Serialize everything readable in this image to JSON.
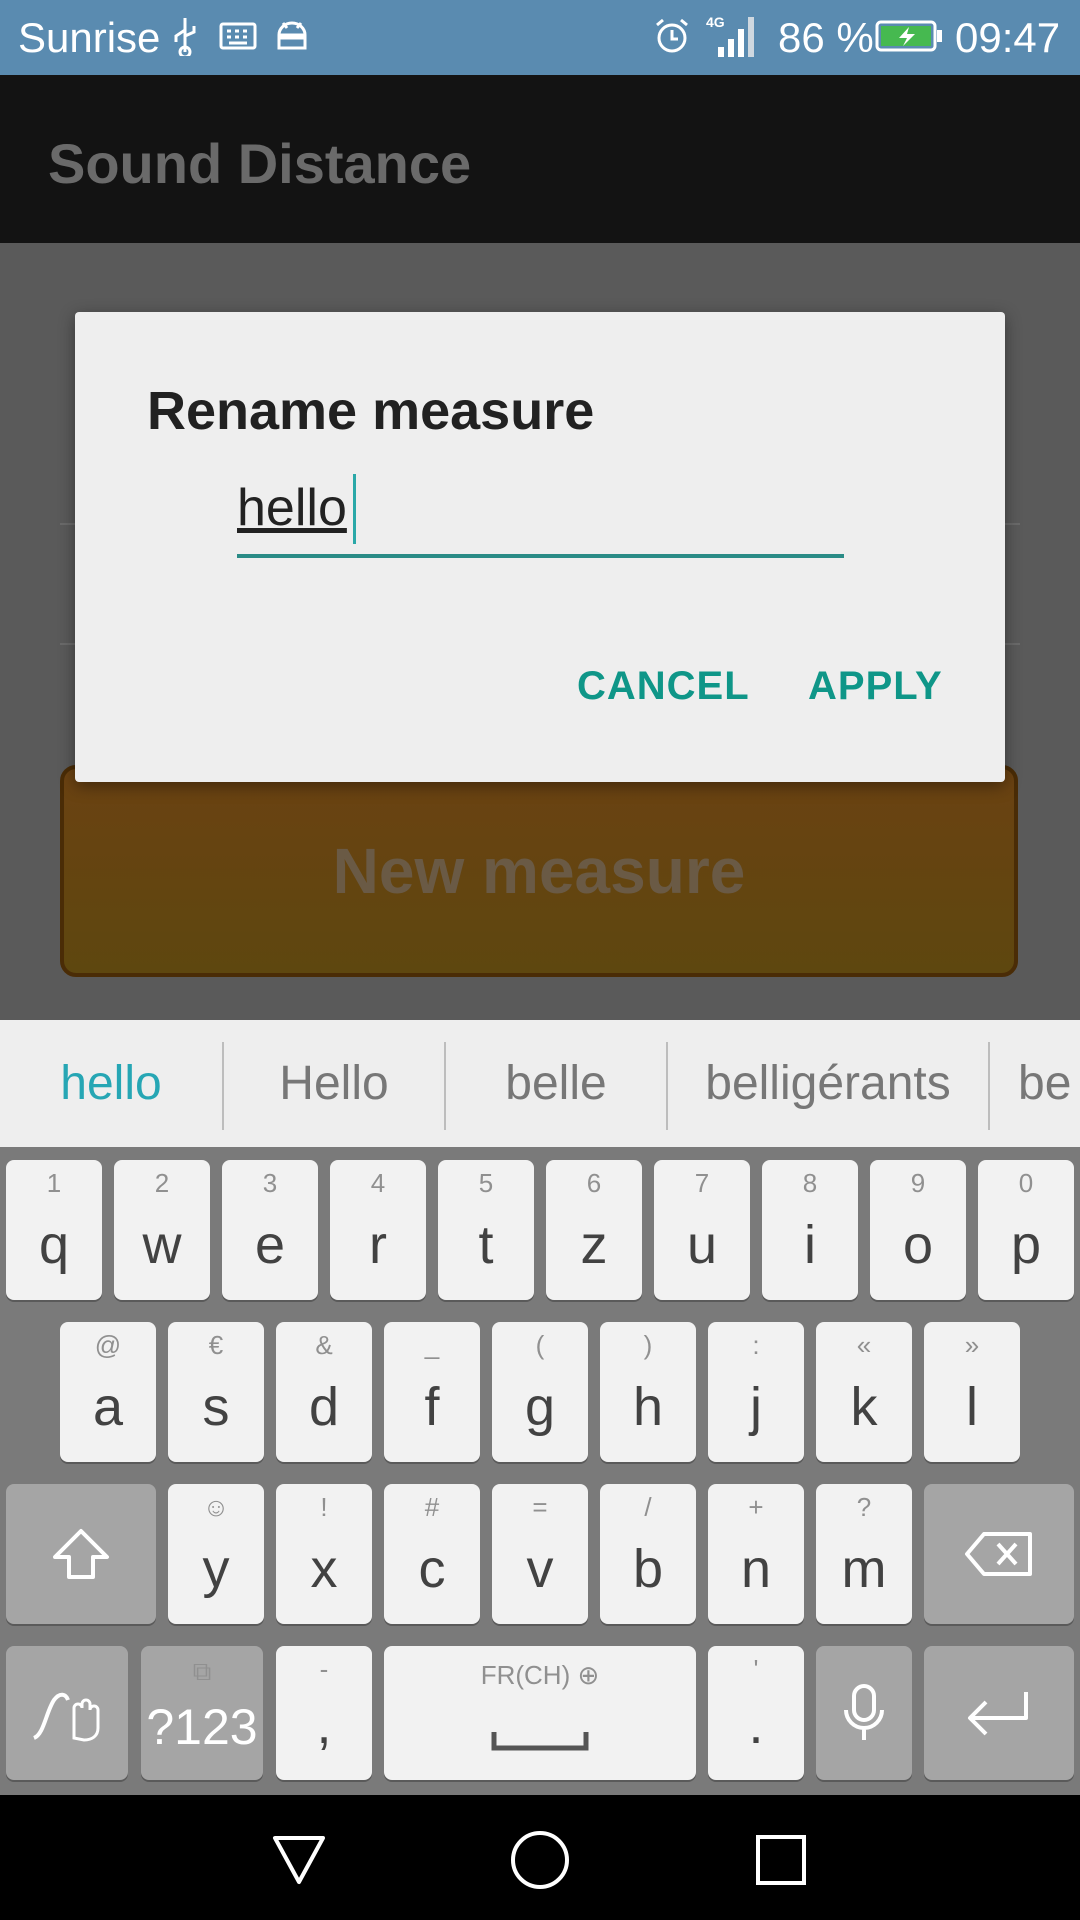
{
  "status": {
    "carrier": "Sunrise",
    "network": "4G",
    "battery_pct": "86 %",
    "time": "09:47",
    "icons": [
      "usb-icon",
      "keyboard-icon",
      "android-icon",
      "alarm-icon",
      "signal-icon",
      "battery-charging-icon"
    ]
  },
  "appbar": {
    "title": "Sound Distance"
  },
  "content": {
    "new_measure_label": "New measure"
  },
  "dialog": {
    "title": "Rename measure",
    "input_value": "hello",
    "cancel_label": "CANCEL",
    "apply_label": "APPLY"
  },
  "keyboard": {
    "suggestions": [
      "hello",
      "Hello",
      "belle",
      "belligérants",
      "be"
    ],
    "accent_color": "#26a6b4",
    "row1": [
      {
        "main": "q",
        "hint": "1"
      },
      {
        "main": "w",
        "hint": "2"
      },
      {
        "main": "e",
        "hint": "3"
      },
      {
        "main": "r",
        "hint": "4"
      },
      {
        "main": "t",
        "hint": "5"
      },
      {
        "main": "z",
        "hint": "6"
      },
      {
        "main": "u",
        "hint": "7"
      },
      {
        "main": "i",
        "hint": "8"
      },
      {
        "main": "o",
        "hint": "9"
      },
      {
        "main": "p",
        "hint": "0"
      }
    ],
    "row2": [
      {
        "main": "a",
        "hint": "@"
      },
      {
        "main": "s",
        "hint": "€"
      },
      {
        "main": "d",
        "hint": "&"
      },
      {
        "main": "f",
        "hint": "_"
      },
      {
        "main": "g",
        "hint": "("
      },
      {
        "main": "h",
        "hint": ")"
      },
      {
        "main": "j",
        "hint": ":"
      },
      {
        "main": "k",
        "hint": "«"
      },
      {
        "main": "l",
        "hint": "»"
      }
    ],
    "row3": [
      {
        "main": "y",
        "hint": "☺"
      },
      {
        "main": "x",
        "hint": "!"
      },
      {
        "main": "c",
        "hint": "#"
      },
      {
        "main": "v",
        "hint": "="
      },
      {
        "main": "b",
        "hint": "/"
      },
      {
        "main": "n",
        "hint": "+"
      },
      {
        "main": "m",
        "hint": "?"
      }
    ],
    "symbols_label": "?123",
    "comma_main": ",",
    "comma_hint": "-",
    "space_hint": "FR(CH) ⊕",
    "period_main": ".",
    "period_hint": "'"
  },
  "navbar": {
    "icons": [
      "back-icon",
      "home-icon",
      "recents-icon"
    ]
  }
}
